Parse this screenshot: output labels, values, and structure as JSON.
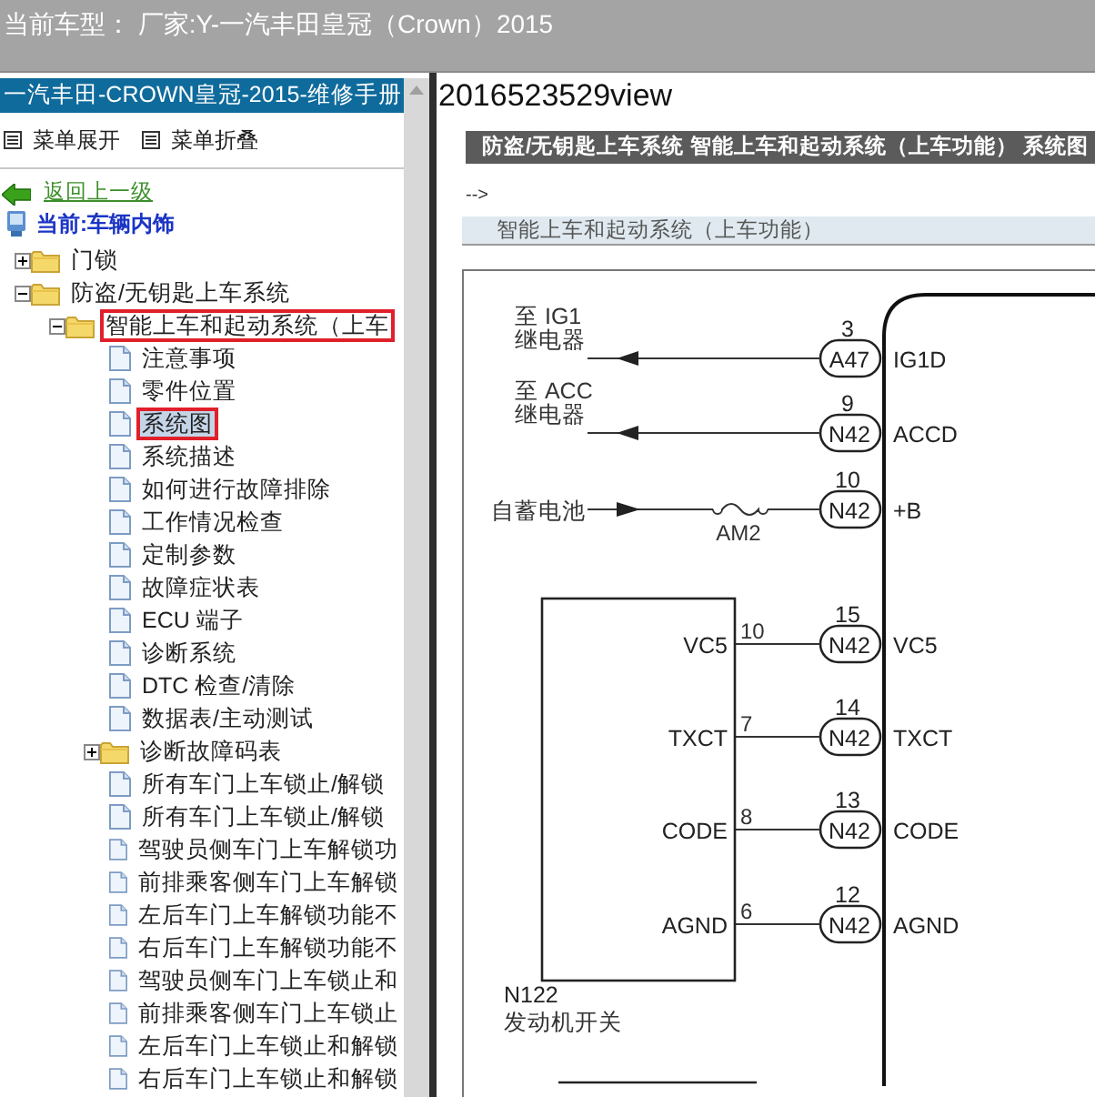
{
  "header": {
    "vehicle_model": "当前车型： 厂家:Y-一汽丰田皇冠（Crown）2015"
  },
  "sidebar": {
    "title": "一汽丰田-CROWN皇冠-2015-维修手册",
    "menu": [
      "菜单展开",
      "菜单折叠"
    ],
    "back_link": "返回上一级",
    "current": "当前:车辆内饰",
    "tree": [
      {
        "label": "门锁",
        "kind": "folder",
        "expanded": false,
        "selected": false,
        "annotated": false
      },
      {
        "label": "防盗/无钥匙上车系统",
        "kind": "folder",
        "expanded": true,
        "selected": false,
        "annotated": false,
        "children": [
          {
            "label": "智能上车和起动系统（上车",
            "kind": "folder",
            "expanded": true,
            "selected": false,
            "annotated": true,
            "children": [
              {
                "label": "注意事项",
                "kind": "page",
                "selected": false,
                "annotated": false
              },
              {
                "label": "零件位置",
                "kind": "page",
                "selected": false,
                "annotated": false
              },
              {
                "label": "系统图",
                "kind": "page",
                "selected": true,
                "annotated": true
              },
              {
                "label": "系统描述",
                "kind": "page",
                "selected": false,
                "annotated": false
              },
              {
                "label": "如何进行故障排除",
                "kind": "page",
                "selected": false,
                "annotated": false
              },
              {
                "label": "工作情况检查",
                "kind": "page",
                "selected": false,
                "annotated": false
              },
              {
                "label": "定制参数",
                "kind": "page",
                "selected": false,
                "annotated": false
              },
              {
                "label": "故障症状表",
                "kind": "page",
                "selected": false,
                "annotated": false
              },
              {
                "label": "ECU 端子",
                "kind": "page",
                "selected": false,
                "annotated": false
              },
              {
                "label": "诊断系统",
                "kind": "page",
                "selected": false,
                "annotated": false
              },
              {
                "label": "DTC 检查/清除",
                "kind": "page",
                "selected": false,
                "annotated": false
              },
              {
                "label": "数据表/主动测试",
                "kind": "page",
                "selected": false,
                "annotated": false
              },
              {
                "label": "诊断故障码表",
                "kind": "folder",
                "expanded": false,
                "selected": false,
                "annotated": false
              },
              {
                "label": "所有车门上车锁止/解锁",
                "kind": "page",
                "selected": false,
                "annotated": false
              },
              {
                "label": "所有车门上车锁止/解锁",
                "kind": "page",
                "selected": false,
                "annotated": false
              },
              {
                "label": "驾驶员侧车门上车解锁功",
                "kind": "page",
                "selected": false,
                "annotated": false
              },
              {
                "label": "前排乘客侧车门上车解锁",
                "kind": "page",
                "selected": false,
                "annotated": false
              },
              {
                "label": "左后车门上车解锁功能不",
                "kind": "page",
                "selected": false,
                "annotated": false
              },
              {
                "label": "右后车门上车解锁功能不",
                "kind": "page",
                "selected": false,
                "annotated": false
              },
              {
                "label": "驾驶员侧车门上车锁止和",
                "kind": "page",
                "selected": false,
                "annotated": false
              },
              {
                "label": "前排乘客侧车门上车锁止",
                "kind": "page",
                "selected": false,
                "annotated": false
              },
              {
                "label": "左后车门上车锁止和解锁",
                "kind": "page",
                "selected": false,
                "annotated": false
              },
              {
                "label": "右后车门上车锁止和解锁",
                "kind": "page",
                "selected": false,
                "annotated": false
              }
            ]
          }
        ]
      }
    ]
  },
  "content": {
    "title": "2016523529view",
    "breadcrumb": "防盗/无钥匙上车系统  智能上车和起动系统（上车功能）  系统图",
    "comment": "-->",
    "section": "智能上车和起动系统（上车功能）",
    "diagram": {
      "wires": [
        {
          "kind": "output",
          "source": [
            "至 IG1",
            "继电器"
          ],
          "pin": "3",
          "connector": "A47",
          "signal": "IG1D"
        },
        {
          "kind": "output",
          "source": [
            "至 ACC",
            "继电器"
          ],
          "pin": "9",
          "connector": "N42",
          "signal": "ACCD"
        },
        {
          "kind": "input",
          "source": [
            "自蓄电池"
          ],
          "fuse": "AM2",
          "pin": "10",
          "connector": "N42",
          "signal": "+B"
        },
        {
          "kind": "switch",
          "switch_pin": "10",
          "switch_signal": "VC5",
          "pin": "15",
          "connector": "N42",
          "signal": "VC5"
        },
        {
          "kind": "switch",
          "switch_pin": "7",
          "switch_signal": "TXCT",
          "pin": "14",
          "connector": "N42",
          "signal": "TXCT"
        },
        {
          "kind": "switch",
          "switch_pin": "8",
          "switch_signal": "CODE",
          "pin": "13",
          "connector": "N42",
          "signal": "CODE"
        },
        {
          "kind": "switch",
          "switch_pin": "6",
          "switch_signal": "AGND",
          "pin": "12",
          "connector": "N42",
          "signal": "AGND"
        }
      ],
      "switch": {
        "code": "N122",
        "name": "发动机开关"
      }
    }
  }
}
